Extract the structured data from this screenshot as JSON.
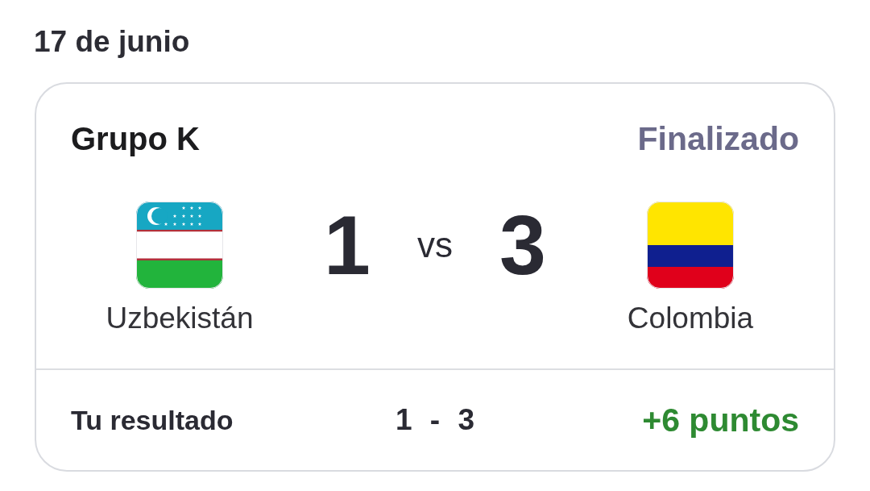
{
  "date": "17 de junio",
  "match": {
    "group": "Grupo K",
    "status": "Finalizado",
    "separator": "vs",
    "teams": [
      {
        "kind": "uzbekistan",
        "name": "Uzbekistán",
        "score": "1"
      },
      {
        "kind": "colombia",
        "name": "Colombia",
        "score": "3"
      }
    ]
  },
  "prediction": {
    "label": "Tu resultado",
    "score": "1 - 3",
    "points": "+6 puntos"
  }
}
